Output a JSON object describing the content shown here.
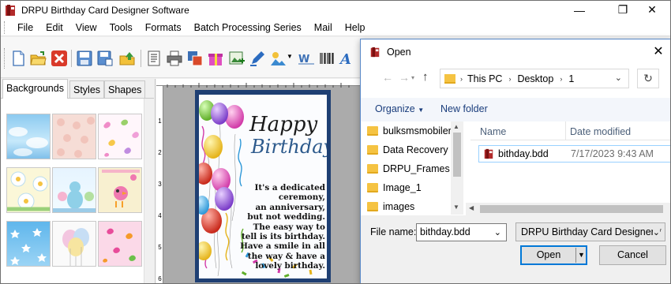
{
  "app": {
    "title": "DRPU Birthday Card Designer Software",
    "window_controls": {
      "minimize": "—",
      "restore": "❐",
      "close": "✕"
    }
  },
  "menu": [
    "File",
    "Edit",
    "View",
    "Tools",
    "Formats",
    "Batch Processing Series",
    "Mail",
    "Help"
  ],
  "toolbar_icons": [
    "new-icon",
    "open-icon",
    "close-icon",
    "save-icon",
    "save-as-icon",
    "export-icon",
    "properties-icon",
    "print-icon",
    "copy-icon",
    "gift-icon",
    "insert-image-icon",
    "pen-icon",
    "image-icon",
    "watermark-icon",
    "barcode-icon",
    "text-icon"
  ],
  "left_panel": {
    "tabs": [
      "Backgrounds",
      "Styles",
      "Shapes"
    ],
    "active_tab": "Backgrounds"
  },
  "ruler": {
    "left_numbers": [
      "1",
      "2",
      "3",
      "4",
      "5",
      "6"
    ]
  },
  "card": {
    "heading_line1": "Happy",
    "heading_line2": "Birthday",
    "message": [
      "It's a dedicated ceremony,",
      "an anniversary,",
      "but not wedding.",
      "The easy way to",
      "tell is its  birthday.",
      "Have a smile in all",
      "the way & have a",
      "lovely birthday."
    ]
  },
  "dialog": {
    "title": "Open",
    "breadcrumb": [
      "This PC",
      "Desktop",
      "1"
    ],
    "organize_label": "Organize",
    "new_folder_label": "New folder",
    "folders": [
      "bulksmsmobiler",
      "Data Recovery",
      "DRPU_Frames",
      "Image_1",
      "images"
    ],
    "columns": {
      "name": "Name",
      "date": "Date modified"
    },
    "files": [
      {
        "name": "bithday.bdd",
        "date": "7/17/2023 9:43 AM"
      }
    ],
    "file_name_label": "File name:",
    "file_name_value": "bithday.bdd",
    "file_type": "DRPU Birthday Card Designer(*",
    "open_button": "Open",
    "cancel_button": "Cancel"
  }
}
